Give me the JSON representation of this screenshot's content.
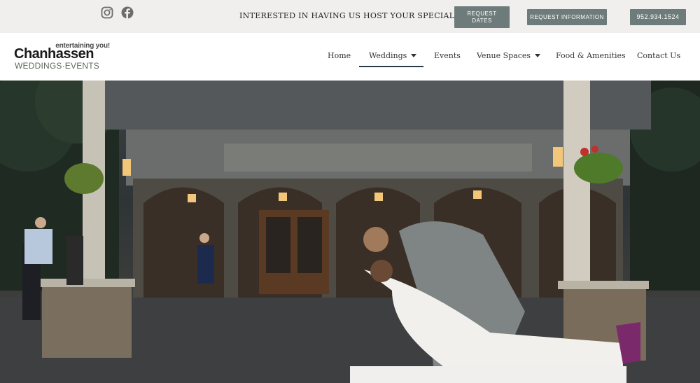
{
  "topbar": {
    "social": [
      {
        "icon": "instagram-icon"
      },
      {
        "icon": "facebook-icon"
      }
    ],
    "promo_text": "INTERESTED IN HAVING US HOST YOUR SPECIAL DAY?",
    "request_dates_label": "REQUEST DATES",
    "request_info_label": "REQUEST INFORMATION",
    "phone_label": "952.934.1524"
  },
  "logo": {
    "tagline": "entertaining you!",
    "name": "Chanhassen",
    "subtitle": "WEDDINGS·EVENTS"
  },
  "nav": {
    "items": [
      {
        "label": "Home"
      },
      {
        "label": "Weddings",
        "dropdown": true,
        "active": true
      },
      {
        "label": "Events"
      },
      {
        "label": "Venue Spaces",
        "dropdown": true
      },
      {
        "label": "Food & Amenities"
      },
      {
        "label": "Contact Us"
      }
    ]
  },
  "colors": {
    "button_bg": "#6e7b7b",
    "topbar_bg": "#f0efed",
    "active_underline": "#2a3a4a"
  }
}
